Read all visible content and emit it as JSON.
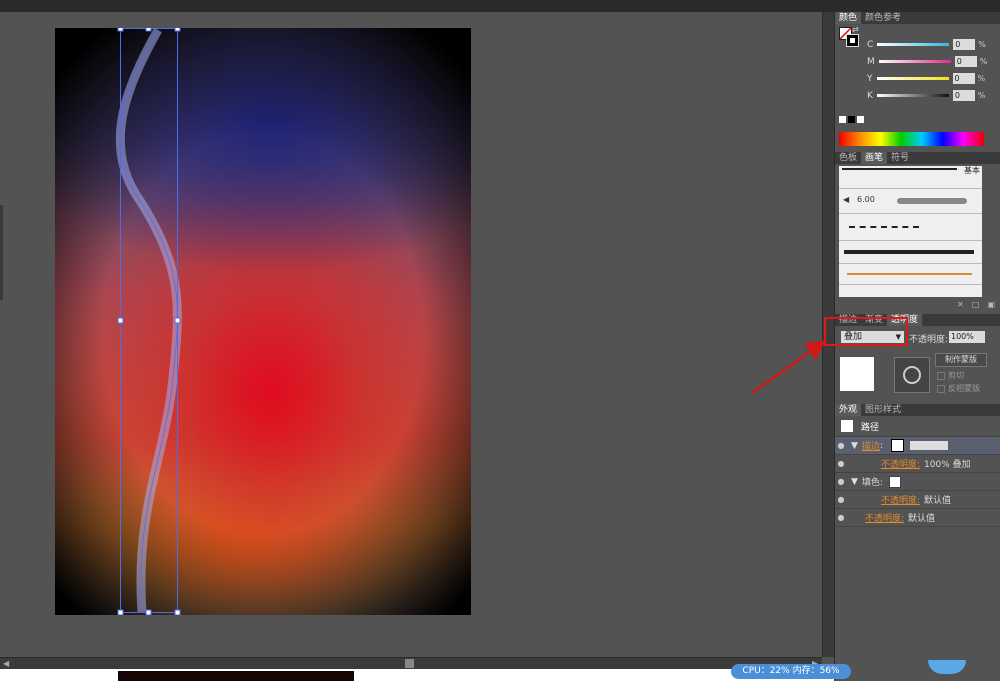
{
  "color_panel": {
    "tabs": [
      "颜色",
      "颜色参考"
    ],
    "channels": [
      {
        "label": "C",
        "value": "0",
        "unit": "%",
        "color": "#2fb8e6"
      },
      {
        "label": "M",
        "value": "0",
        "unit": "%",
        "color": "#e02a8a"
      },
      {
        "label": "Y",
        "value": "0",
        "unit": "%",
        "color": "#f2e21a"
      },
      {
        "label": "K",
        "value": "0",
        "unit": "%",
        "color": "#111111"
      }
    ]
  },
  "brush_panel": {
    "tabs": [
      "色板",
      "画笔",
      "符号"
    ],
    "active_tab": "画笔",
    "basic_label": "基本",
    "brush_size": "6.00"
  },
  "transparency_panel": {
    "tabs": [
      "描边",
      "渐变",
      "透明度"
    ],
    "active_tab": "透明度",
    "blend_mode": "叠加",
    "opacity_label": "不透明度:",
    "opacity_value": "100%",
    "make_mask_button": "制作蒙版",
    "clip_label": "剪切",
    "invert_mask_label": "反相蒙版"
  },
  "appearance_panel": {
    "tabs": [
      "外观",
      "图形样式"
    ],
    "header": "路径",
    "rows": [
      {
        "label": "描边",
        "value": ":",
        "link": true
      },
      {
        "label": "不透明度:",
        "value": "100% 叠加",
        "link": true
      },
      {
        "label": "填色:",
        "value": "",
        "link": false
      },
      {
        "label": "不透明度:",
        "value": "默认值",
        "link": true
      },
      {
        "label": "不透明度:",
        "value": "默认值",
        "link": true
      }
    ]
  },
  "status": {
    "cpu_text": "CPU：22%  内存：56%"
  }
}
